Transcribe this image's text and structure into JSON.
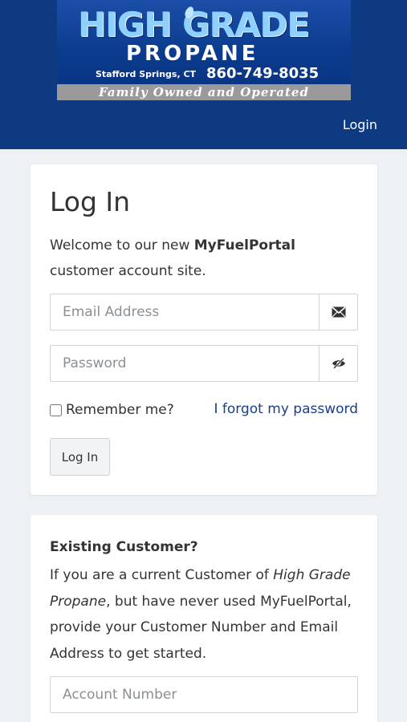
{
  "logo": {
    "title": "HIGH GRADE",
    "subtitle": "PROPANE",
    "location": "Stafford Springs, CT",
    "phone": "860-749-8035",
    "tagline": "Family Owned and Operated"
  },
  "nav": {
    "login_label": "Login"
  },
  "login_card": {
    "title": "Log In",
    "welcome_pre": "Welcome to our new ",
    "welcome_brand": "MyFuelPortal",
    "welcome_post": " customer account site.",
    "email_placeholder": "Email Address",
    "password_placeholder": "Password",
    "remember_label": "Remember me?",
    "forgot_label": "I forgot my password",
    "submit_label": "Log In",
    "icons": {
      "email": "envelope-icon",
      "password": "eye-slash-icon"
    }
  },
  "existing_card": {
    "heading": "Existing Customer?",
    "text_pre": "If you are a current Customer of ",
    "text_company": "High Grade Propane",
    "text_post": ", but have never used MyFuelPortal, provide your Customer Number and Email Address to get started.",
    "account_placeholder": "Account Number"
  },
  "colors": {
    "header": "#0d3a80",
    "link": "#1a3d8f",
    "background": "#eef1f4"
  }
}
